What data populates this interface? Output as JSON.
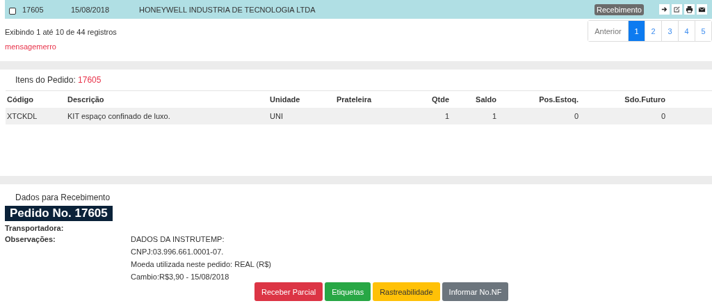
{
  "orders_table": {
    "rows": [
      {
        "checked": false,
        "number": "17605",
        "date": "15/08/2018",
        "supplier": "HONEYWELL INDUSTRIA DE TECNOLOGIA LTDA",
        "tooltip": "Recebimento",
        "actions": [
          {
            "kind": "arrow"
          },
          {
            "kind": "edit"
          },
          {
            "kind": "print"
          },
          {
            "kind": "mail"
          }
        ]
      }
    ]
  },
  "record_info": "Exibindo 1 até 10 de 44 registros",
  "error_message": "mensagemerro",
  "pagination": {
    "previous": "Anterior",
    "pages": [
      {
        "label": "1",
        "selected": true
      },
      {
        "label": "2",
        "selected": false
      },
      {
        "label": "3",
        "selected": false
      },
      {
        "label": "4",
        "selected": false
      },
      {
        "label": "5",
        "selected": false
      }
    ]
  },
  "items": {
    "title": "Itens do Pedido:",
    "order_number": "17605",
    "columns": [
      "Código",
      "Descrição",
      "Unidade",
      "Prateleira",
      "Qtde",
      "Saldo",
      "Pos.Estoq.",
      "Sdo.Futuro"
    ],
    "rows": [
      [
        "XTCKDL",
        "KIT espaço confinado de luxo.",
        "UNI",
        "",
        "1",
        "1",
        "0",
        "0"
      ]
    ]
  },
  "receiving": {
    "title": "Dados para Recebimento",
    "order_heading": "Pedido No. 17605",
    "fields": [
      {
        "label": "Transportadora:"
      },
      {
        "label": "Observações:",
        "lines": [
          "DADOS DA INSTRUTEMP:",
          "CNPJ:03.996.661.0001-07.",
          "Moeda utilizada neste pedido: REAL (R$)",
          "Cambio:R$3,90 - 15/08/2018"
        ]
      }
    ],
    "buttons": [
      {
        "label": "Receber Parcial",
        "kind": "danger"
      },
      {
        "label": "Etiquetas",
        "kind": "success"
      },
      {
        "label": "Rastreabilidade",
        "kind": "warning"
      },
      {
        "label": "Informar No.NF",
        "kind": "secondary"
      }
    ]
  }
}
